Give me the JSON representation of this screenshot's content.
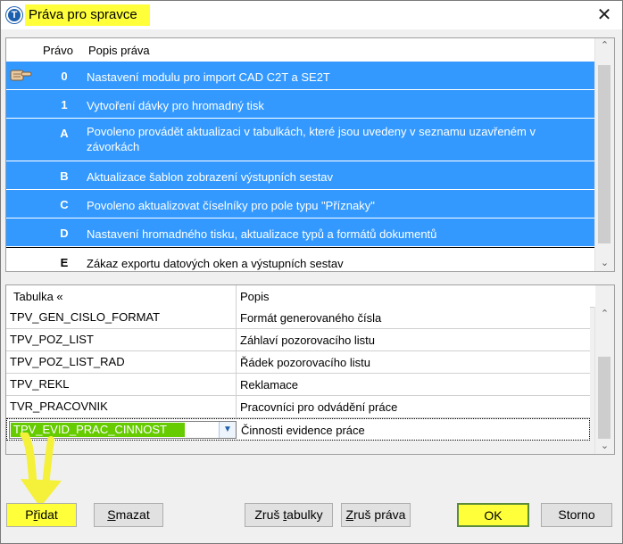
{
  "window": {
    "title": "Práva pro spravce",
    "close_glyph": "✕",
    "app_icon": "T"
  },
  "rights_grid": {
    "columns": [
      "Právo",
      "Popis práva"
    ],
    "rows": [
      {
        "code": "0",
        "desc": "Nastavení modulu pro import CAD C2T a SE2T",
        "selected": true,
        "current": true
      },
      {
        "code": "1",
        "desc": "Vytvoření dávky pro hromadný tisk",
        "selected": true
      },
      {
        "code": "A",
        "desc": "Povoleno provádět aktualizaci v  tabulkách, které jsou  uvedeny v seznamu uzavřeném v závorkách",
        "selected": true
      },
      {
        "code": "B",
        "desc": "Aktualizace šablon zobrazení výstupních sestav",
        "selected": true
      },
      {
        "code": "C",
        "desc": "Povoleno aktualizovat číselníky pro pole typu \"Příznaky\"",
        "selected": true
      },
      {
        "code": "D",
        "desc": "Nastavení hromadného tisku, aktualizace typů a formátů dokumentů",
        "selected": true
      },
      {
        "code": "E",
        "desc": "Zákaz exportu datových oken a výstupních sestav",
        "selected": false
      }
    ]
  },
  "tables_grid": {
    "columns": [
      "Tabulka «",
      "Popis"
    ],
    "rows": [
      {
        "table": "TPV_GEN_CISLO_FORMAT",
        "desc": "Formát generovaného čísla"
      },
      {
        "table": "TPV_POZ_LIST",
        "desc": "Záhlaví pozorovacího listu"
      },
      {
        "table": "TPV_POZ_LIST_RAD",
        "desc": "Řádek pozorovacího listu"
      },
      {
        "table": "TPV_REKL",
        "desc": "Reklamace"
      },
      {
        "table": "TVR_PRACOVNIK",
        "desc": "Pracovníci pro odvádění práce"
      }
    ],
    "editing_row": {
      "table": "TPV_EVID_PRAC_CINNOST",
      "desc": "Činnosti evidence práce"
    }
  },
  "buttons": {
    "add": {
      "pre": "P",
      "ul": "ř",
      "post": "idat"
    },
    "delete": {
      "pre": "",
      "ul": "S",
      "post": "mazat"
    },
    "cancel_tables": {
      "pre": "Zruš ",
      "ul": "t",
      "post": "abulky"
    },
    "cancel_rights": {
      "pre": "",
      "ul": "Z",
      "post": "ruš práva"
    },
    "ok": "OK",
    "storno": "Storno"
  },
  "highlight_color": "#ffff3a",
  "selection_color": "#3399ff",
  "combo_highlight_color": "#66cc00"
}
